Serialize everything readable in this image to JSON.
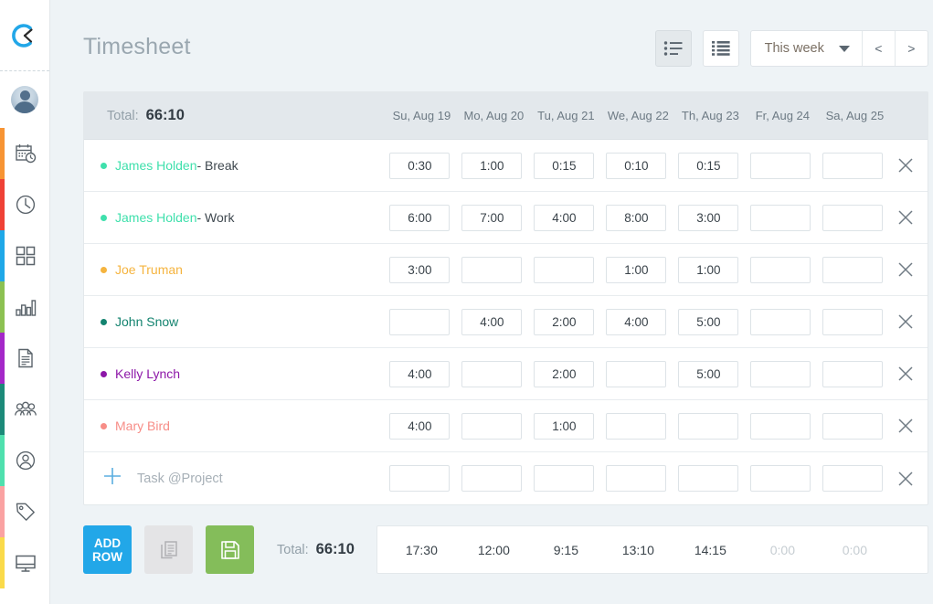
{
  "app": {
    "logo_icon": "clock-logo-icon",
    "accent_blue": "#22a7e8",
    "green": "#84bd5a"
  },
  "sidebar": {
    "avatar_name": "user-avatar",
    "items": [
      {
        "icon": "calendar-clock-icon",
        "bar_color": "#f79433",
        "name": "sidebar-item-calendar"
      },
      {
        "icon": "clock-icon",
        "bar_color": "#ef4136",
        "name": "sidebar-item-time"
      },
      {
        "icon": "grid-icon",
        "bar_color": "#1fa8e8",
        "name": "sidebar-item-dashboard"
      },
      {
        "icon": "bar-chart-icon",
        "bar_color": "#8cc152",
        "name": "sidebar-item-reports"
      },
      {
        "icon": "document-icon",
        "bar_color": "#a428c8",
        "name": "sidebar-item-documents"
      },
      {
        "icon": "group-icon",
        "bar_color": "#1c8a79",
        "name": "sidebar-item-team"
      },
      {
        "icon": "person-circle-icon",
        "bar_color": "#4fe0ae",
        "name": "sidebar-item-profile"
      },
      {
        "icon": "tag-icon",
        "bar_color": "#faa2a2",
        "name": "sidebar-item-tags"
      },
      {
        "icon": "monitor-icon",
        "bar_color": "#fada4a",
        "name": "sidebar-item-kiosk"
      }
    ]
  },
  "header": {
    "title": "Timesheet",
    "view_list_icon": "list-view-icon",
    "view_grid_icon": "detailed-list-view-icon",
    "period": "This week",
    "prev_label": "<",
    "next_label": ">"
  },
  "sheet": {
    "total_label": "Total:",
    "total_value": "66:10",
    "days": [
      "Su, Aug 19",
      "Mo, Aug 20",
      "Tu, Aug 21",
      "We, Aug 22",
      "Th, Aug 23",
      "Fr, Aug 24",
      "Sa, Aug 25"
    ],
    "rows": [
      {
        "name": "James Holden",
        "suffix": " - Break",
        "color": "#3fe0ac",
        "values": [
          "0:30",
          "1:00",
          "0:15",
          "0:10",
          "0:15",
          "",
          ""
        ]
      },
      {
        "name": "James Holden",
        "suffix": " - Work",
        "color": "#3fe0ac",
        "values": [
          "6:00",
          "7:00",
          "4:00",
          "8:00",
          "3:00",
          "",
          ""
        ]
      },
      {
        "name": "Joe Truman",
        "suffix": "",
        "color": "#f5b43f",
        "values": [
          "3:00",
          "",
          "",
          "1:00",
          "1:00",
          "",
          ""
        ]
      },
      {
        "name": "John Snow",
        "suffix": "",
        "color": "#13836f",
        "values": [
          "",
          "4:00",
          "2:00",
          "4:00",
          "5:00",
          "",
          ""
        ]
      },
      {
        "name": "Kelly Lynch",
        "suffix": "",
        "color": "#8d17a8",
        "values": [
          "4:00",
          "",
          "2:00",
          "",
          "5:00",
          "",
          ""
        ]
      },
      {
        "name": "Mary Bird",
        "suffix": "",
        "color": "#f78d87",
        "values": [
          "4:00",
          "",
          "1:00",
          "",
          "",
          "",
          ""
        ]
      }
    ],
    "add_row": {
      "plus_icon": "plus-icon",
      "placeholder": "Task @Project",
      "values": [
        "",
        "",
        "",
        "",
        "",
        "",
        ""
      ]
    },
    "delete_icon": "close-icon"
  },
  "footer": {
    "add_row_line1": "ADD",
    "add_row_line2": "ROW",
    "copy_icon": "copy-icon",
    "save_icon": "save-icon",
    "total_label": "Total:",
    "total_value": "66:10",
    "day_totals": [
      "17:30",
      "12:00",
      "9:15",
      "13:10",
      "14:15",
      "0:00",
      "0:00"
    ]
  }
}
